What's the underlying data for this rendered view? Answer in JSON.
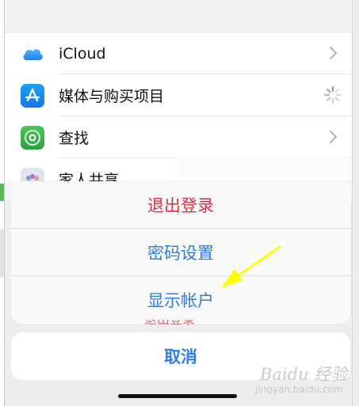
{
  "settings": {
    "items": [
      {
        "label": "iCloud",
        "icon": "cloud-icon",
        "accessory": "chevron"
      },
      {
        "label": "媒体与购买项目",
        "icon": "app-store-icon",
        "accessory": "spinner"
      },
      {
        "label": "查找",
        "icon": "find-my-icon",
        "accessory": "chevron"
      },
      {
        "label": "家人共享",
        "icon": "family-sharing-icon",
        "accessory": "none"
      }
    ]
  },
  "action_sheet": {
    "actions": [
      {
        "label": "退出登录",
        "style": "destructive"
      },
      {
        "label": "密码设置",
        "style": "default"
      },
      {
        "label": "显示帐户",
        "style": "default"
      }
    ],
    "cancel_label": "取消"
  },
  "background_text": "退出登录",
  "watermark": {
    "main": "Baidu 经验",
    "sub": "jingyan.baidu.com"
  },
  "colors": {
    "destructive": "#e0303e",
    "accent": "#2b7de9",
    "arrow": "#ffff00"
  }
}
